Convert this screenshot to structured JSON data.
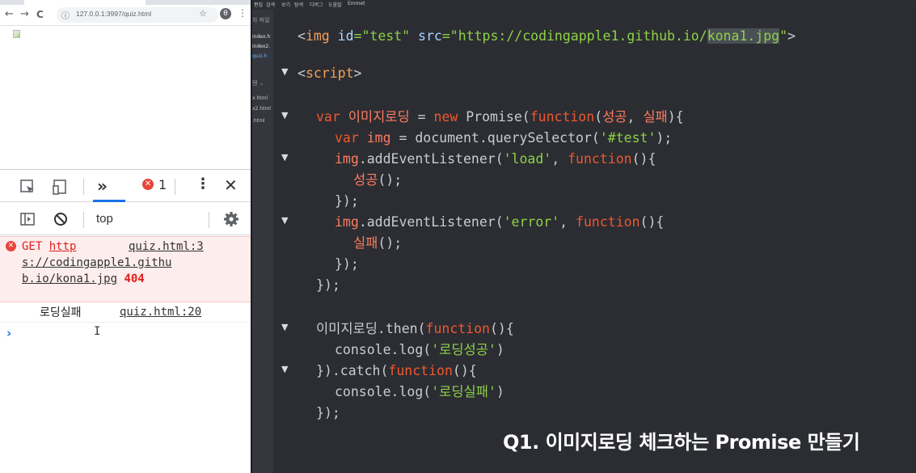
{
  "browser": {
    "url": "127.0.0.1:3997/quiz.html",
    "back_icon": "←",
    "forward_icon": "→",
    "reload_icon": "C",
    "info_icon": "ⓘ",
    "star_icon": "☆",
    "profile_icon": "θ",
    "menu_icon": "⋮"
  },
  "devtools": {
    "more_tabs": "»",
    "error_badge": "✕",
    "error_count": "1",
    "kebab": "⋮",
    "close": "✕",
    "context": "top"
  },
  "console": {
    "error": {
      "method": "GET",
      "url_part1": "http",
      "url_part2": "s://codingapple1.githu",
      "url_part3": "b.io/kona1.jpg",
      "status": "404",
      "source": "quiz.html:3"
    },
    "log": {
      "text": "로딩실패",
      "source": "quiz.html:20"
    },
    "prompt": "›",
    "ibeam": "I"
  },
  "sidebar": {
    "header": "자 파일",
    "files": [
      "index.h",
      "index2.",
      "quiz.h"
    ],
    "header2": "탠 ⌄",
    "files2": [
      "x.html",
      "x2.html",
      ".html"
    ]
  },
  "menubar": [
    "편집",
    "검색",
    "보기",
    "탐색",
    "디버그",
    "도움말",
    "Emmet"
  ],
  "code": {
    "l1": {
      "t1": "<",
      "t2": "img",
      "t3": " id",
      "t4": "=\"test\"",
      "t5": " src",
      "t6": "=\"https://codingapple1.github.io/",
      "t7": "kona1.jpg",
      "t8": "\"",
      "t9": ">"
    },
    "l2": {
      "t1": "<",
      "t2": "script",
      "t3": ">"
    },
    "l3": {
      "t1": "var ",
      "t2": "이미지로딩",
      "t3": " = ",
      "t4": "new ",
      "t5": "Promise(",
      "t6": "function",
      "t7": "(",
      "t8": "성공",
      "t9": ", ",
      "t10": "실패",
      "t11": "){"
    },
    "l4": {
      "t1": "var ",
      "t2": "img",
      "t3": " = document.querySelector(",
      "t4": "'#test'",
      "t5": ");"
    },
    "l5": {
      "t1": "img",
      "t2": ".addEventListener(",
      "t3": "'load'",
      "t4": ", ",
      "t5": "function",
      "t6": "(){"
    },
    "l6": {
      "t1": "성공",
      "t2": "();"
    },
    "l7": {
      "t1": "});"
    },
    "l8": {
      "t1": "img",
      "t2": ".addEventListener(",
      "t3": "'error'",
      "t4": ", ",
      "t5": "function",
      "t6": "(){"
    },
    "l9": {
      "t1": "실패",
      "t2": "();"
    },
    "l10": {
      "t1": "});"
    },
    "l11": {
      "t1": "});"
    },
    "l12": {
      "t1": "이미지로딩",
      "t2": ".then(",
      "t3": "function",
      "t4": "(){"
    },
    "l13": {
      "t1": "console.log(",
      "t2": "'로딩성공'",
      "t3": ")"
    },
    "l14": {
      "t1": "}).catch(",
      "t2": "function",
      "t3": "(){"
    },
    "l15": {
      "t1": "console.log(",
      "t2": "'로딩실패'",
      "t3": ")"
    },
    "l16": {
      "t1": "});"
    },
    "fold_marker": "▼"
  },
  "caption": "Q1. 이미지로딩 체크하는 Promise 만들기",
  "colors": {
    "keyword": "#f0582e",
    "string": "#8ed146",
    "variable": "#ff7c5e",
    "editor_bg": "#2b2d33",
    "error_red": "#e0201c"
  }
}
